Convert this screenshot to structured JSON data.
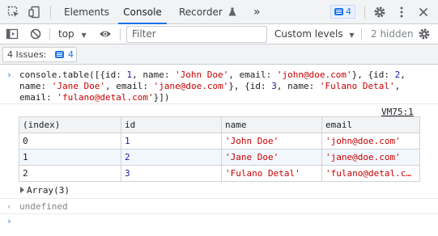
{
  "tabs": {
    "elements": "Elements",
    "console": "Console",
    "recorder": "Recorder",
    "more": "»",
    "issues_badge": "4"
  },
  "toolbar": {
    "context": "top",
    "filter_placeholder": "Filter",
    "levels": "Custom levels",
    "hidden": "2 hidden"
  },
  "issues": {
    "label": "4 Issues:",
    "count": "4"
  },
  "command": {
    "line1_pre": "console.table([{id: ",
    "line1_n1": "1",
    "line1_mid": ", name: ",
    "line1_s1": "'John Doe'",
    "line1_mid2": ", email: ",
    "line1_s2": "'john@doe.com'",
    "line1_mid3": "}, {id: ",
    "line1_n2": "2",
    "line1_end": ",",
    "line2_pre": "name: ",
    "line2_s1": "'Jane Doe'",
    "line2_mid": ", email: ",
    "line2_s2": "'jane@doe.com'",
    "line2_mid2": "}, {id: ",
    "line2_n3": "3",
    "line2_mid3": ", name: ",
    "line2_s3": "'Fulano Detal'",
    "line2_end": ",",
    "line3_pre": "email: ",
    "line3_s1": "'fulano@detal.com'",
    "line3_end": "}])"
  },
  "source_link": "VM75:1",
  "table": {
    "headers": [
      "(index)",
      "id",
      "name",
      "email"
    ],
    "rows": [
      {
        "index": "0",
        "id": "1",
        "name": "'John Doe'",
        "email": "'john@doe.com'"
      },
      {
        "index": "1",
        "id": "2",
        "name": "'Jane Doe'",
        "email": "'jane@doe.com'"
      },
      {
        "index": "2",
        "id": "3",
        "name": "'Fulano Detal'",
        "email": "'fulano@detal.com'"
      }
    ]
  },
  "array_summary": "Array(3)",
  "result": "undefined",
  "colors": {
    "accent": "#1a73e8",
    "string": "#c80000",
    "number": "#1a1aa6"
  }
}
